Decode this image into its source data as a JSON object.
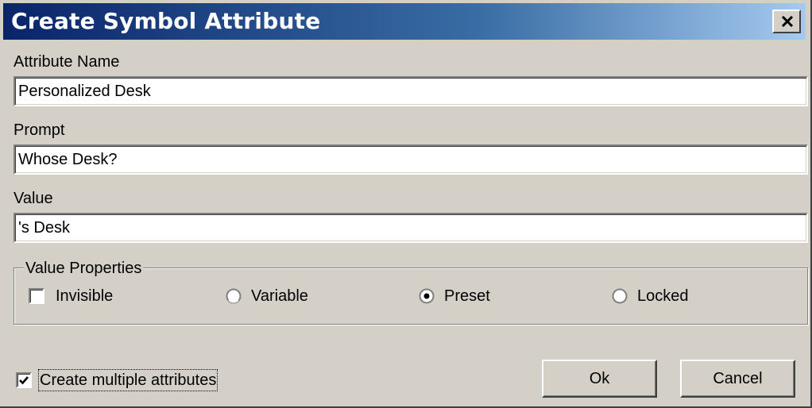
{
  "window": {
    "title": "Create Symbol Attribute",
    "close_glyph": "×",
    "close_icon": "close-icon",
    "title_gradient": [
      "#0a246a",
      "#3a6ea5",
      "#a6caf0"
    ],
    "face_color": "#d4d0c8"
  },
  "fields": {
    "attribute_name": {
      "label": "Attribute Name",
      "value": "Personalized Desk"
    },
    "prompt": {
      "label": "Prompt",
      "value": "Whose Desk?"
    },
    "value": {
      "label": "Value",
      "value": "'s Desk"
    }
  },
  "value_properties": {
    "legend": "Value Properties",
    "invisible": {
      "label": "Invisible",
      "checked": false
    },
    "radios": [
      {
        "label": "Variable",
        "selected": false
      },
      {
        "label": "Preset",
        "selected": true
      },
      {
        "label": "Locked",
        "selected": false
      }
    ]
  },
  "create_multiple": {
    "label": "Create multiple attributes",
    "checked": true
  },
  "buttons": {
    "ok": "Ok",
    "cancel": "Cancel"
  }
}
